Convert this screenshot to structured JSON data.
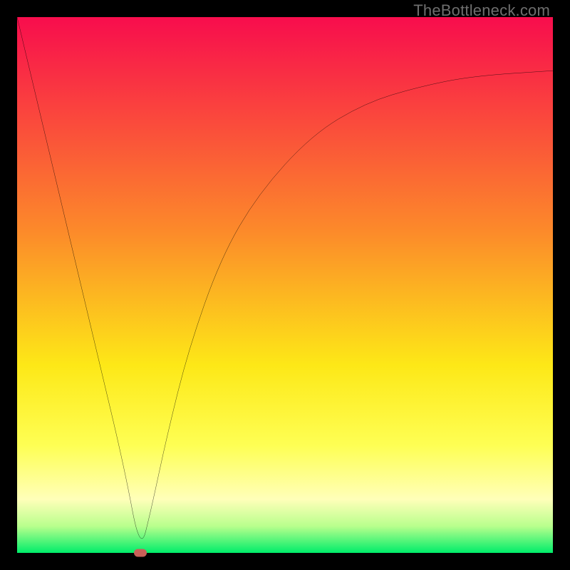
{
  "watermark": "TheBottleneck.com",
  "colors": {
    "gradient_stops": [
      {
        "offset": 0,
        "color": "#f80d4d"
      },
      {
        "offset": 40,
        "color": "#fc8a2a"
      },
      {
        "offset": 65,
        "color": "#fde817"
      },
      {
        "offset": 80,
        "color": "#feff54"
      },
      {
        "offset": 90,
        "color": "#ffffb9"
      },
      {
        "offset": 95,
        "color": "#b9ff8d"
      },
      {
        "offset": 100,
        "color": "#00ed6a"
      }
    ],
    "curve": "#000000",
    "marker": "#c86058",
    "frame": "#000000"
  },
  "chart_data": {
    "type": "line",
    "title": "",
    "xlabel": "",
    "ylabel": "",
    "xlim": [
      0,
      100
    ],
    "ylim": [
      0,
      100
    ],
    "grid": false,
    "legend": false,
    "series": [
      {
        "name": "bottleneck-curve",
        "x": [
          0,
          5,
          10,
          15,
          20,
          23,
          25,
          28,
          32,
          38,
          45,
          55,
          65,
          75,
          85,
          100
        ],
        "y": [
          100,
          79,
          58,
          37,
          16,
          0,
          8,
          22,
          38,
          55,
          67,
          78,
          84,
          87,
          89,
          90
        ]
      }
    ],
    "annotations": [
      {
        "name": "minimum-marker",
        "x": 23,
        "y": 0
      }
    ]
  }
}
